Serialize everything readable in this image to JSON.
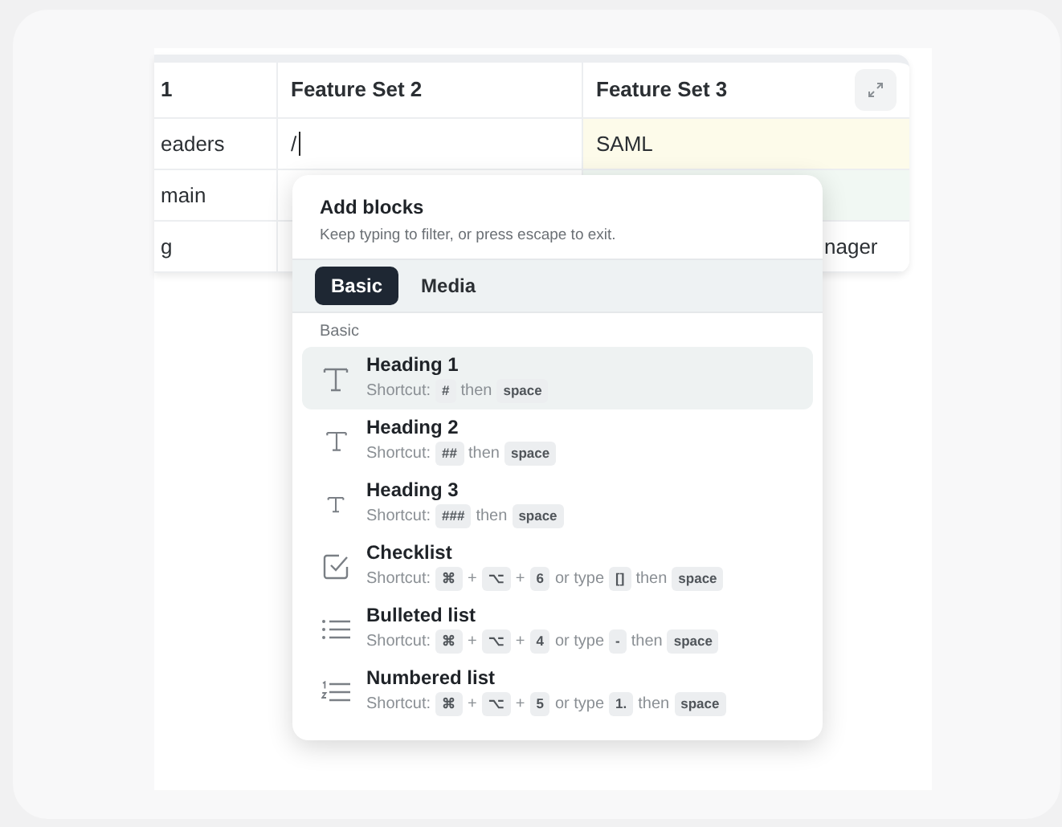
{
  "table": {
    "columns": [
      "1",
      "Feature Set 2",
      "Feature Set 3"
    ],
    "rows": [
      {
        "cells": [
          "eaders",
          "/",
          "SAML"
        ],
        "editing": true,
        "color": "#fdfbea"
      },
      {
        "cells": [
          "main",
          "",
          ""
        ],
        "color": "#f1f8f3"
      },
      {
        "cells": [
          "g",
          "",
          "nager"
        ],
        "color": "#ffffff"
      }
    ]
  },
  "menu": {
    "title": "Add blocks",
    "subtitle": "Keep typing to filter, or press escape to exit.",
    "tabs": [
      {
        "label": "Basic",
        "selected": true
      },
      {
        "label": "Media",
        "selected": false
      }
    ],
    "section": "Basic",
    "items": [
      {
        "title": "Heading 1",
        "selected": true,
        "shortcut": [
          {
            "kind": "text",
            "text": "Shortcut:"
          },
          {
            "kind": "key",
            "text": "#"
          },
          {
            "kind": "text",
            "text": "then"
          },
          {
            "kind": "key",
            "text": "space"
          }
        ]
      },
      {
        "title": "Heading 2",
        "selected": false,
        "shortcut": [
          {
            "kind": "text",
            "text": "Shortcut:"
          },
          {
            "kind": "key",
            "text": "##"
          },
          {
            "kind": "text",
            "text": "then"
          },
          {
            "kind": "key",
            "text": "space"
          }
        ]
      },
      {
        "title": "Heading 3",
        "selected": false,
        "shortcut": [
          {
            "kind": "text",
            "text": "Shortcut:"
          },
          {
            "kind": "key",
            "text": "###"
          },
          {
            "kind": "text",
            "text": "then"
          },
          {
            "kind": "key",
            "text": "space"
          }
        ]
      },
      {
        "title": "Checklist",
        "selected": false,
        "shortcut": [
          {
            "kind": "text",
            "text": "Shortcut:"
          },
          {
            "kind": "key",
            "text": "⌘"
          },
          {
            "kind": "text",
            "text": "+"
          },
          {
            "kind": "key",
            "text": "⌥"
          },
          {
            "kind": "text",
            "text": "+"
          },
          {
            "kind": "key",
            "text": "6"
          },
          {
            "kind": "text",
            "text": "or type"
          },
          {
            "kind": "key",
            "text": "[]"
          },
          {
            "kind": "text",
            "text": "then"
          },
          {
            "kind": "key",
            "text": "space"
          }
        ]
      },
      {
        "title": "Bulleted list",
        "selected": false,
        "shortcut": [
          {
            "kind": "text",
            "text": "Shortcut:"
          },
          {
            "kind": "key",
            "text": "⌘"
          },
          {
            "kind": "text",
            "text": "+"
          },
          {
            "kind": "key",
            "text": "⌥"
          },
          {
            "kind": "text",
            "text": "+"
          },
          {
            "kind": "key",
            "text": "4"
          },
          {
            "kind": "text",
            "text": "or type"
          },
          {
            "kind": "key",
            "text": "-"
          },
          {
            "kind": "text",
            "text": "then"
          },
          {
            "kind": "key",
            "text": "space"
          }
        ]
      },
      {
        "title": "Numbered list",
        "selected": false,
        "shortcut": [
          {
            "kind": "text",
            "text": "Shortcut:"
          },
          {
            "kind": "key",
            "text": "⌘"
          },
          {
            "kind": "text",
            "text": "+"
          },
          {
            "kind": "key",
            "text": "⌥"
          },
          {
            "kind": "text",
            "text": "+"
          },
          {
            "kind": "key",
            "text": "5"
          },
          {
            "kind": "text",
            "text": "or type"
          },
          {
            "kind": "key",
            "text": "1."
          },
          {
            "kind": "text",
            "text": "then"
          },
          {
            "kind": "key",
            "text": "space"
          }
        ]
      }
    ]
  }
}
